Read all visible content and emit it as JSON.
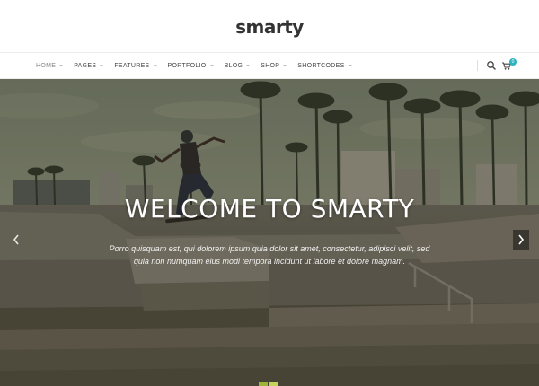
{
  "brand": {
    "logo": "smarty"
  },
  "nav": {
    "items": [
      {
        "label": "HOME",
        "active": true
      },
      {
        "label": "PAGES"
      },
      {
        "label": "FEATURES"
      },
      {
        "label": "PORTFOLIO"
      },
      {
        "label": "BLOG"
      },
      {
        "label": "SHOP"
      },
      {
        "label": "SHORTCODES"
      }
    ],
    "icons": {
      "search": "search-icon",
      "cart": "cart-icon"
    },
    "cart_count": "0"
  },
  "hero": {
    "title": "WELCOME TO SMARTY",
    "line1": "Porro quisquam est, qui dolorem ipsum quia dolor sit amet, consectetur, adipisci velit, sed",
    "line2": "quia non numquam eius modi tempora incidunt ut labore et dolore magnam.",
    "prev_icon": "chevron-left-icon",
    "next_icon": "chevron-right-icon",
    "background": "skatepark-photo"
  },
  "colors": {
    "accent": "#2bb3c0",
    "slider_dot": "#9fb53a"
  }
}
